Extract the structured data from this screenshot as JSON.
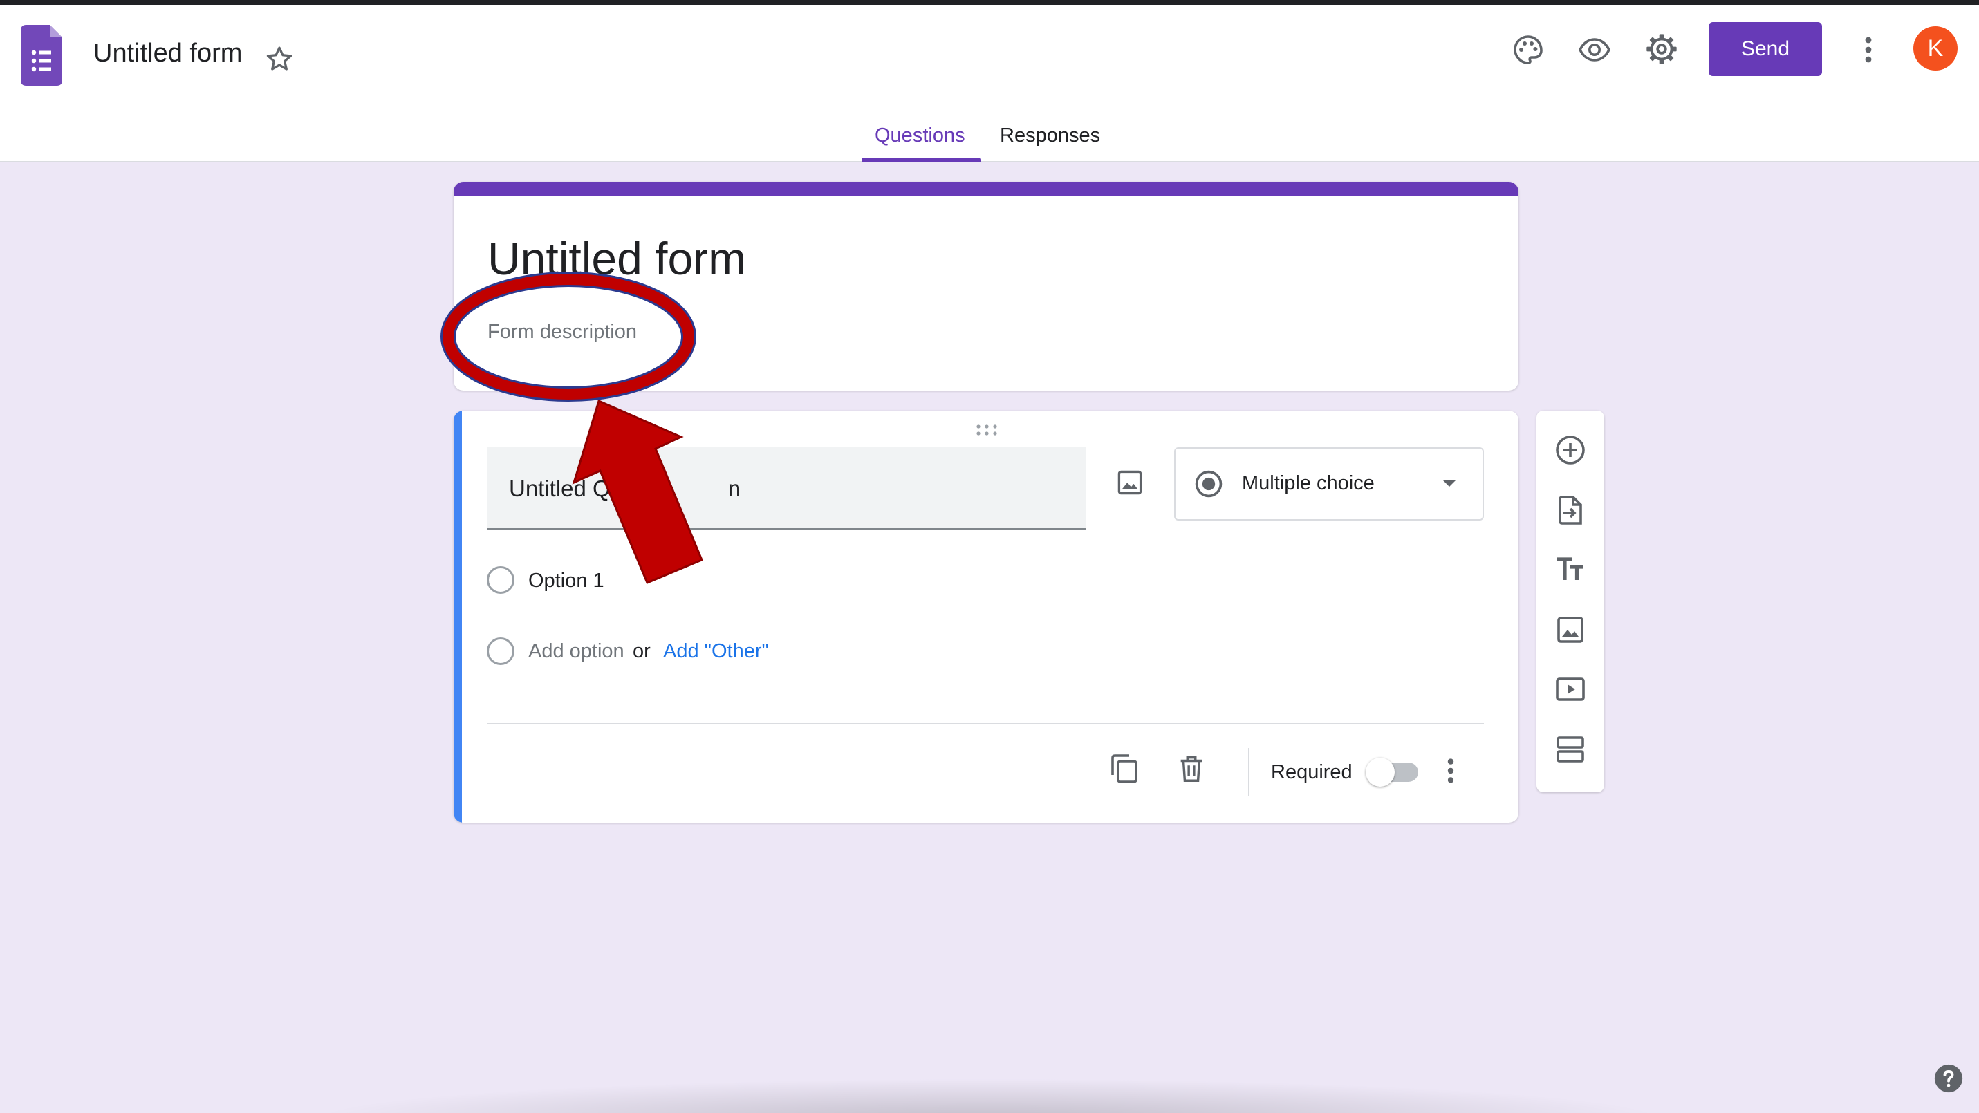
{
  "app": {
    "title": "Untitled form"
  },
  "header": {
    "send_label": "Send",
    "avatar_letter": "K",
    "icons": [
      "forms-logo-icon",
      "star-icon",
      "palette-icon",
      "eye-icon",
      "gear-icon",
      "more-vert-icon"
    ]
  },
  "tabs": [
    {
      "label": "Questions",
      "active": true
    },
    {
      "label": "Responses",
      "active": false
    }
  ],
  "form": {
    "title": "Untitled form",
    "description_placeholder": "Form description"
  },
  "question": {
    "title": "Untitled Question",
    "title_visible_fragment_1": "Untitled Q",
    "title_visible_fragment_2": "n",
    "type": "Multiple choice",
    "options": [
      "Option 1"
    ],
    "add_option_label": "Add option",
    "or_label": "or",
    "add_other_label": "Add \"Other\"",
    "required_label": "Required",
    "required": false
  },
  "side_toolbar": {
    "icons": [
      "add-question-icon",
      "import-questions-icon",
      "add-title-icon",
      "add-image-icon",
      "add-video-icon",
      "add-section-icon"
    ]
  },
  "annotation": {
    "highlight_color": "#c00000",
    "target": "form-description"
  },
  "colors": {
    "accent": "#673ab7",
    "background": "#ede7f6",
    "question_bar": "#4285f4",
    "avatar": "#f4511e",
    "link": "#1a73e8"
  }
}
